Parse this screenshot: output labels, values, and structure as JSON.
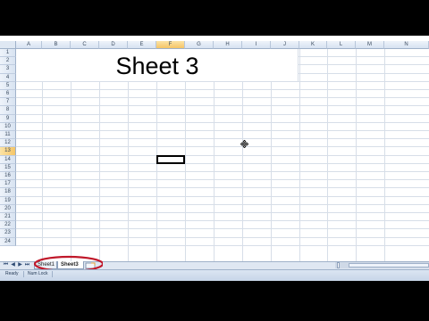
{
  "columns": [
    "A",
    "B",
    "C",
    "D",
    "E",
    "F",
    "G",
    "H",
    "I",
    "J",
    "K",
    "L",
    "M",
    "N"
  ],
  "selected_column": "F",
  "rows": [
    "1",
    "2",
    "3",
    "4",
    "5",
    "6",
    "7",
    "8",
    "9",
    "10",
    "11",
    "12",
    "13",
    "14",
    "15",
    "16",
    "17",
    "18",
    "19",
    "20",
    "21",
    "22",
    "23",
    "24"
  ],
  "selected_row": "13",
  "cell_text": "Sheet 3",
  "tabs": [
    "Sheet1",
    "Sheet3"
  ],
  "active_tab": "Sheet3",
  "status": {
    "ready": "Ready",
    "num_lock": "Num Lock"
  },
  "colors": {
    "annotation": "#c0182a",
    "header_selected": "#f5c566",
    "grid": "#d7dee8"
  },
  "icons": [
    "nav-first-icon",
    "nav-prev-icon",
    "nav-next-icon",
    "nav-last-icon",
    "insert-sheet-icon",
    "move-cursor-icon"
  ]
}
